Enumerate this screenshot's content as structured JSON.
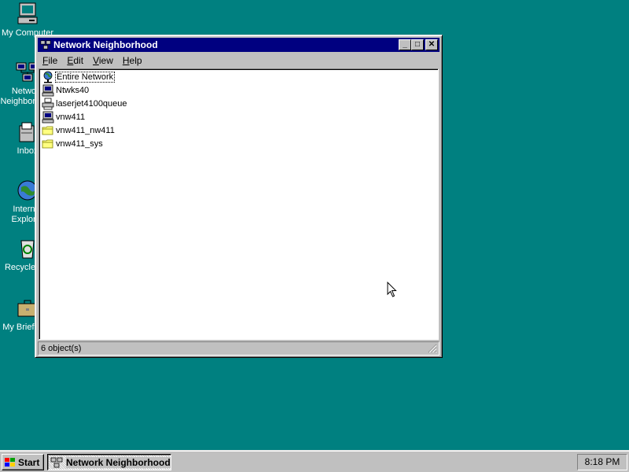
{
  "desktop": {
    "icons": [
      {
        "label": "My Computer",
        "icon": "my-computer-icon"
      },
      {
        "label": "Network Neighborhood",
        "icon": "network-neighborhood-icon"
      },
      {
        "label": "Inbox",
        "icon": "inbox-icon"
      },
      {
        "label": "Internet Explorer",
        "icon": "internet-explorer-icon"
      },
      {
        "label": "Recycle Bin",
        "icon": "recycle-bin-icon"
      },
      {
        "label": "My Briefcase",
        "icon": "briefcase-icon"
      }
    ]
  },
  "window": {
    "title": "Network Neighborhood",
    "buttons": {
      "minimize": "_",
      "maximize": "□",
      "close": "✕"
    },
    "menu": [
      {
        "label": "File",
        "key": "F",
        "rest": "ile"
      },
      {
        "label": "Edit",
        "key": "E",
        "rest": "dit"
      },
      {
        "label": "View",
        "key": "V",
        "rest": "iew"
      },
      {
        "label": "Help",
        "key": "H",
        "rest": "elp"
      }
    ],
    "items": [
      {
        "label": "Entire Network",
        "icon": "globe-network-icon",
        "selected": true
      },
      {
        "label": "Ntwks40",
        "icon": "computer-icon"
      },
      {
        "label": "laserjet4100queue",
        "icon": "printer-icon"
      },
      {
        "label": "vnw411",
        "icon": "computer-icon"
      },
      {
        "label": "vnw411_nw411",
        "icon": "folder-icon"
      },
      {
        "label": "vnw411_sys",
        "icon": "folder-icon"
      }
    ],
    "status": "6 object(s)"
  },
  "taskbar": {
    "start_label": "Start",
    "task_label": "Network Neighborhood",
    "clock": "8:18 PM"
  },
  "colors": {
    "desktop": "#008080",
    "titlebar": "#000080",
    "face": "#c0c0c0"
  }
}
